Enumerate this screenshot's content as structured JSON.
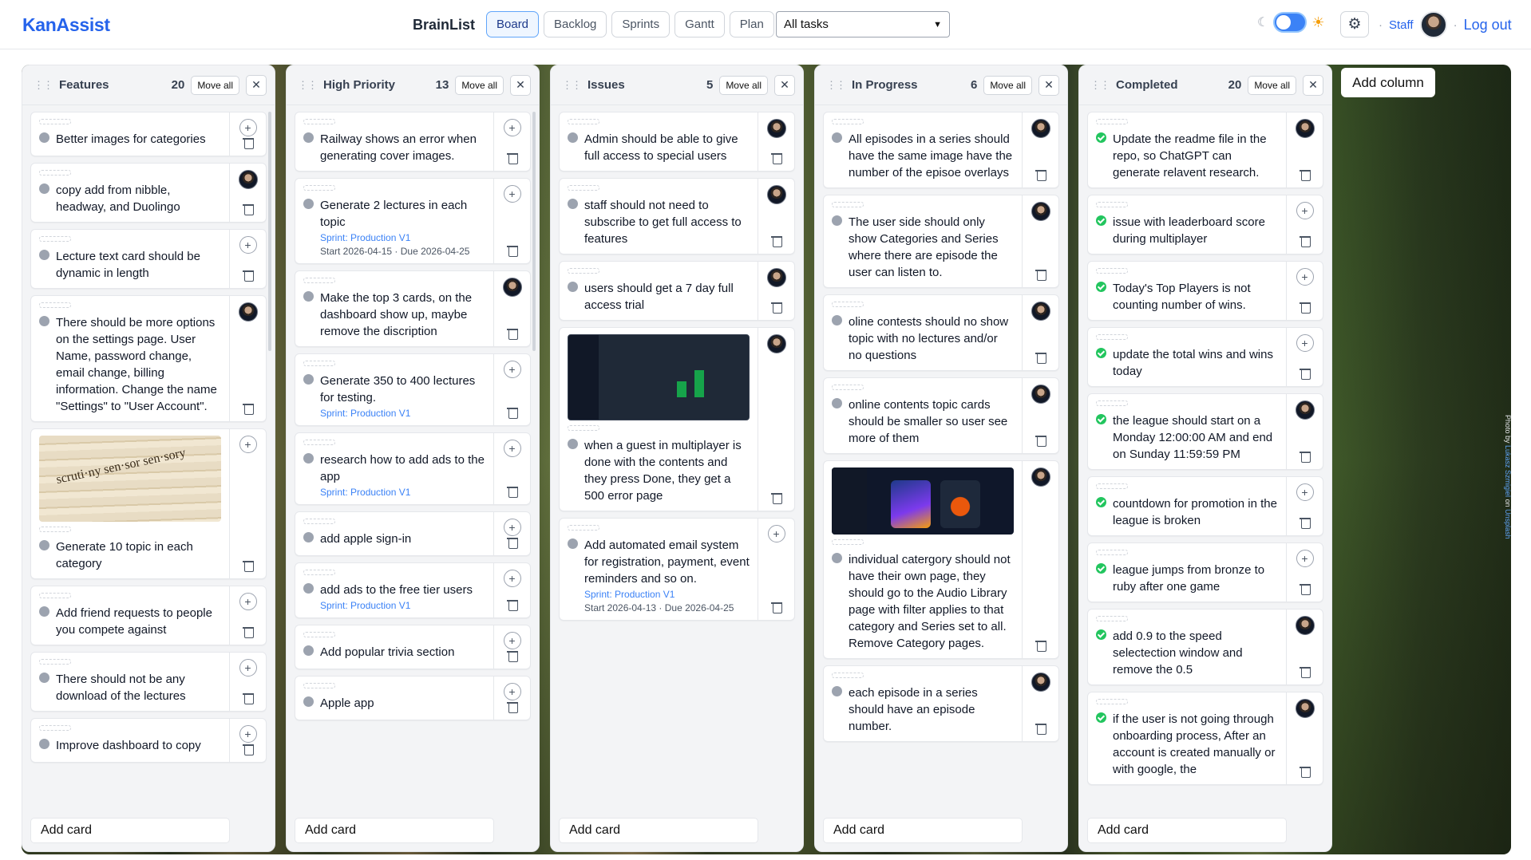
{
  "app": {
    "logo": "KanAssist",
    "project": "BrainList",
    "tabs": [
      "Board",
      "Backlog",
      "Sprints",
      "Gantt",
      "Plan"
    ],
    "active_tab": "Board",
    "filter": "All tasks",
    "user": "Staff",
    "logout": "Log out",
    "accent": "#2563eb"
  },
  "board": {
    "add_column": "Add column",
    "add_card": "Add card",
    "move_all": "Move all",
    "photo_credit": {
      "prefix": "Photo by ",
      "author": "Lukasz Szmigiel",
      "mid": " on ",
      "site": "Unsplash"
    },
    "columns": [
      {
        "title": "Features",
        "count": "20",
        "cards": [
          {
            "text": "Better images for categories",
            "side": "plus"
          },
          {
            "text": "copy add from nibble, headway, and Duolingo",
            "side": "avatar"
          },
          {
            "text": "Lecture text card should be dynamic in length",
            "side": "plus"
          },
          {
            "text": "There should be more options on the settings page. User Name, password change, email change, billing information. Change the name \"Settings\" to \"User Account\".",
            "side": "avatar"
          },
          {
            "text": "Generate 10 topic in each category",
            "side": "plus",
            "image": "dict"
          },
          {
            "text": "Add friend requests to people you compete against",
            "side": "plus"
          },
          {
            "text": "There should not be any download of the lectures",
            "side": "plus"
          },
          {
            "text": "Improve dashboard to copy",
            "side": "plus"
          }
        ]
      },
      {
        "title": "High Priority",
        "count": "13",
        "cards": [
          {
            "text": "Railway shows an error when generating cover images.",
            "side": "plus"
          },
          {
            "text": "Generate 2 lectures in each topic",
            "side": "plus",
            "sprint": "Sprint: Production V1",
            "dates": "Start 2026-04-15 · Due 2026-04-25"
          },
          {
            "text": "Make the top 3 cards, on the dashboard show up, maybe remove the discription",
            "side": "avatar"
          },
          {
            "text": "Generate 350 to 400 lectures for testing.",
            "side": "plus",
            "sprint": "Sprint: Production V1"
          },
          {
            "text": "research how to add ads to the app",
            "side": "plus",
            "sprint": "Sprint: Production V1"
          },
          {
            "text": "add apple sign-in",
            "side": "plus"
          },
          {
            "text": "add ads to the free tier users",
            "side": "plus",
            "sprint": "Sprint: Production V1"
          },
          {
            "text": "Add popular trivia section",
            "side": "plus"
          },
          {
            "text": "Apple app",
            "side": "plus"
          }
        ]
      },
      {
        "title": "Issues",
        "count": "5",
        "cards": [
          {
            "text": "Admin should be able to give full access to special users",
            "side": "avatar"
          },
          {
            "text": "staff should not need to subscribe to get full access to features",
            "side": "avatar"
          },
          {
            "text": "users should get a 7 day full access trial",
            "side": "avatar"
          },
          {
            "text": "when a guest in multiplayer is done with the contents and they press Done, they get a 500 error page",
            "side": "avatar",
            "image": "dark"
          },
          {
            "text": "Add automated email system for registration, payment, event reminders and so on.",
            "side": "plus",
            "sprint": "Sprint: Production V1",
            "dates": "Start 2026-04-13 · Due 2026-04-25"
          }
        ]
      },
      {
        "title": "In Progress",
        "count": "6",
        "cards": [
          {
            "text": "All episodes in a series should have the same image have the number of the episoe overlays",
            "side": "avatar"
          },
          {
            "text": "The user side should only show Categories and Series where there are episode the user can listen to.",
            "side": "avatar"
          },
          {
            "text": "oline contests should no show topic with no lectures and/or no questions",
            "side": "avatar"
          },
          {
            "text": "online contents topic cards should be smaller so user see more of them",
            "side": "avatar"
          },
          {
            "text": "individual catergory should not have their own page, they should go to the Audio Library page with filter applies to that category and Series set to all. Remove Category pages.",
            "side": "avatar",
            "image": "dark2"
          },
          {
            "text": "each episode in a series should have an episode number.",
            "side": "avatar"
          }
        ]
      },
      {
        "title": "Completed",
        "count": "20",
        "done": true,
        "cards": [
          {
            "text": "Update the readme file in the repo, so ChatGPT can generate relavent research.",
            "side": "avatar"
          },
          {
            "text": "issue with leaderboard score during multiplayer",
            "side": "plus"
          },
          {
            "text": "Today's Top Players is not counting number of wins.",
            "side": "plus"
          },
          {
            "text": "update the total wins and wins today",
            "side": "plus"
          },
          {
            "text": "the league should start on a Monday 12:00:00 AM and end on Sunday 11:59:59 PM",
            "side": "avatar"
          },
          {
            "text": "countdown for promotion in the league is broken",
            "side": "plus"
          },
          {
            "text": "league jumps from bronze to ruby after one game",
            "side": "plus"
          },
          {
            "text": "add 0.9 to the speed selectection window and remove the 0.5",
            "side": "avatar"
          },
          {
            "text": "if the user is not going through onboarding process, After an account is created manually or with google, the",
            "side": "avatar"
          }
        ]
      }
    ]
  }
}
